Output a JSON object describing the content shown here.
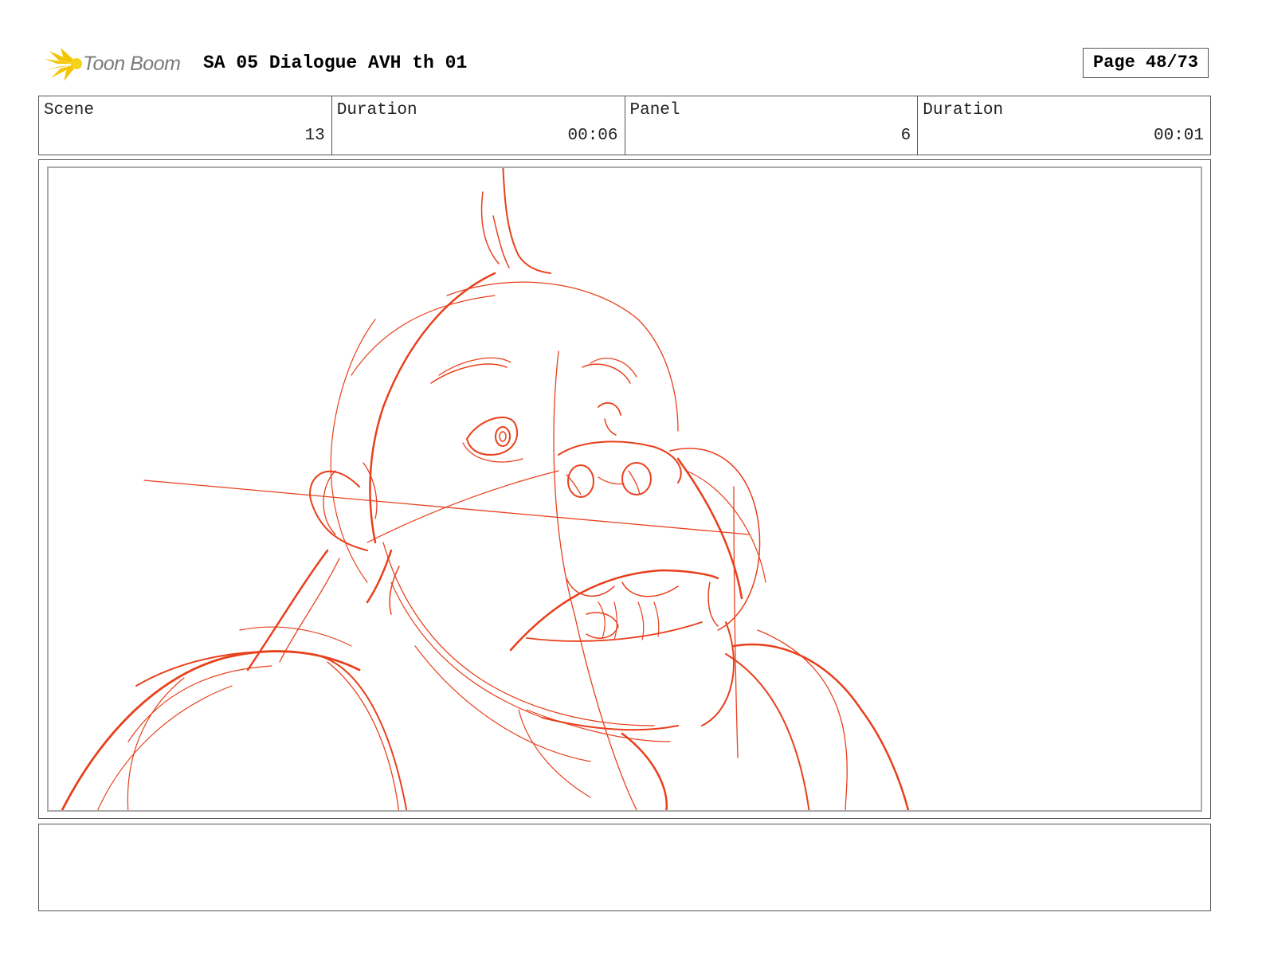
{
  "header": {
    "logo_text": "Toon Boom",
    "title": "SA 05 Dialogue AVH th 01",
    "page_label": "Page 48/73"
  },
  "info": [
    {
      "label": "Scene",
      "value": "13"
    },
    {
      "label": "Duration",
      "value": "00:06"
    },
    {
      "label": "Panel",
      "value": "6"
    },
    {
      "label": "Duration",
      "value": "00:01"
    }
  ],
  "colors": {
    "sketch": "#e8401c",
    "logo_yellow": "#f5c400",
    "logo_text": "#7a7a7a"
  },
  "notes": ""
}
